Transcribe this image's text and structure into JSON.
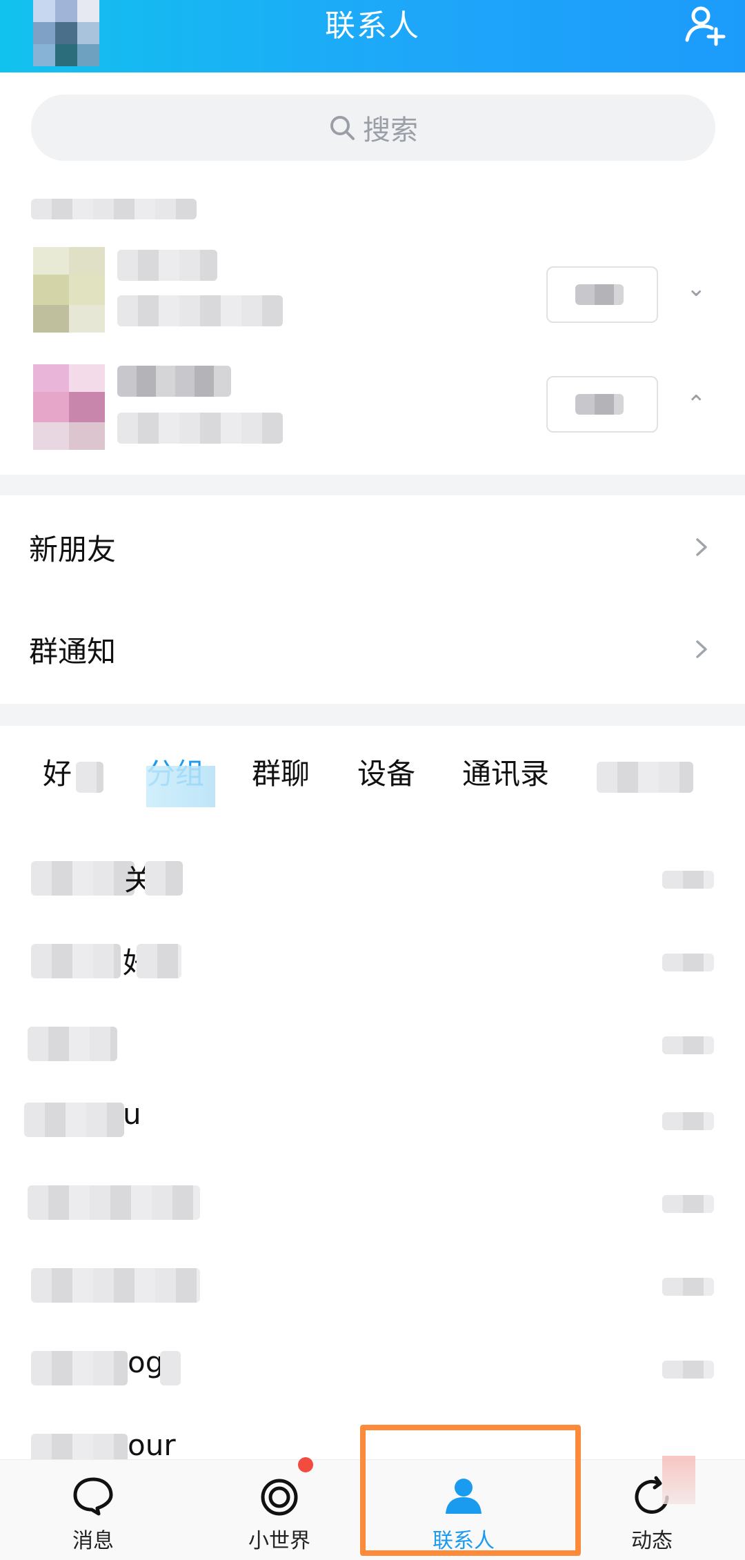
{
  "header": {
    "title": "联系人"
  },
  "search": {
    "placeholder": "搜索"
  },
  "menu": [
    {
      "label": "新朋友"
    },
    {
      "label": "群通知"
    }
  ],
  "tabs": [
    {
      "label": "好"
    },
    {
      "label": "分组"
    },
    {
      "label": "群聊"
    },
    {
      "label": "设备"
    },
    {
      "label": "通讯录"
    }
  ],
  "friend_rows_visible_fragments": [
    "关",
    "好",
    "",
    "u",
    "",
    "",
    "og",
    "our"
  ],
  "bottom_nav": [
    {
      "label": "消息",
      "icon": "message-icon"
    },
    {
      "label": "小世界",
      "icon": "small-world-icon",
      "badge": true
    },
    {
      "label": "联系人",
      "icon": "contacts-icon",
      "active": true
    },
    {
      "label": "动态",
      "icon": "moments-icon"
    }
  ],
  "colors": {
    "header_start": "#12c2ee",
    "header_end": "#1c9bfb",
    "accent": "#1b9bf0",
    "badge": "#f24b3f",
    "highlight": "#fb8b3b"
  }
}
